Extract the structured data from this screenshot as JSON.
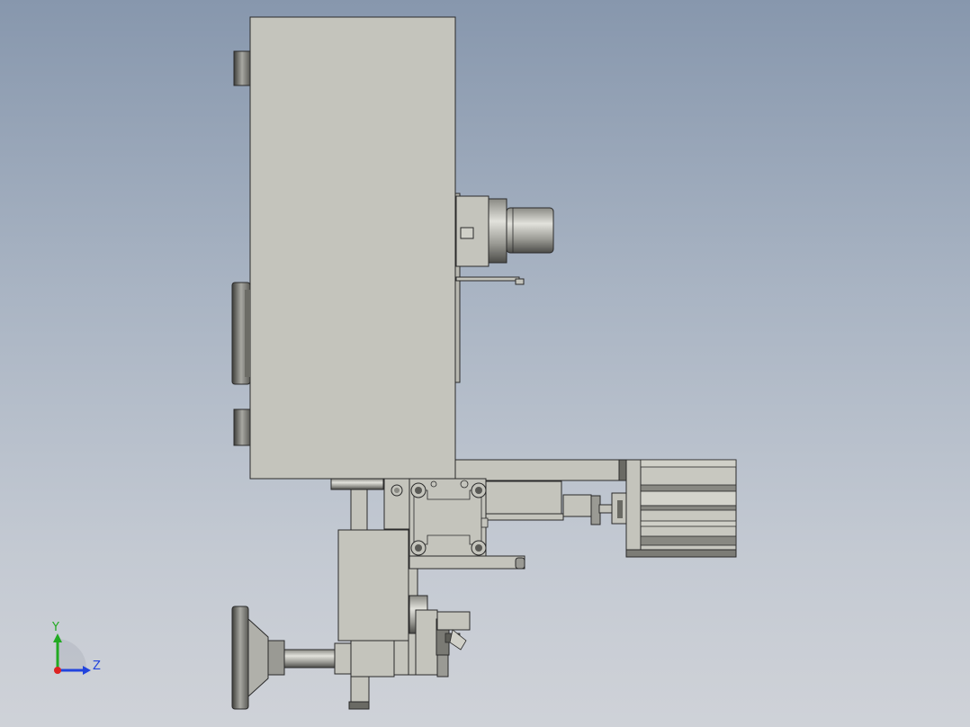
{
  "viewport": {
    "background_top": "#8797ad",
    "background_bottom": "#cfd2d8",
    "part_fill": "#c4c4bc",
    "edge_color": "#2a2a2a",
    "shaded_dark": "#5c5c56"
  },
  "triad": {
    "y_label": "Y",
    "z_label": "Z",
    "y_color": "#22aa22",
    "z_color": "#2244dd",
    "x_color": "#dd2222"
  }
}
